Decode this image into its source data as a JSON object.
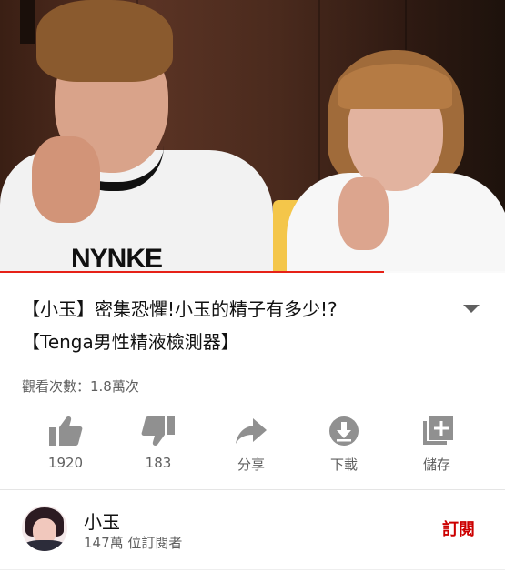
{
  "video": {
    "progress_fraction": 0.76,
    "progress_color": "#e62117",
    "shirt_logo": "NYNKE"
  },
  "title": {
    "line1": "【小玉】密集恐懼!小玉的精子有多少!?",
    "line2": "【Tenga男性精液檢測器】",
    "expand_icon": "chevron-down-icon"
  },
  "views": "觀看次數：1.8萬次",
  "actions": [
    {
      "name": "like",
      "icon": "thumbs-up-icon",
      "label": "1920"
    },
    {
      "name": "dislike",
      "icon": "thumbs-down-icon",
      "label": "183"
    },
    {
      "name": "share",
      "icon": "share-arrow-icon",
      "label": "分享"
    },
    {
      "name": "download",
      "icon": "download-icon",
      "label": "下載"
    },
    {
      "name": "save",
      "icon": "add-to-playlist-icon",
      "label": "儲存"
    }
  ],
  "channel": {
    "name": "小玉",
    "subscribers": "147萬 位訂閱者",
    "subscribe_label": "訂閱",
    "subscribe_color": "#cc0000"
  }
}
